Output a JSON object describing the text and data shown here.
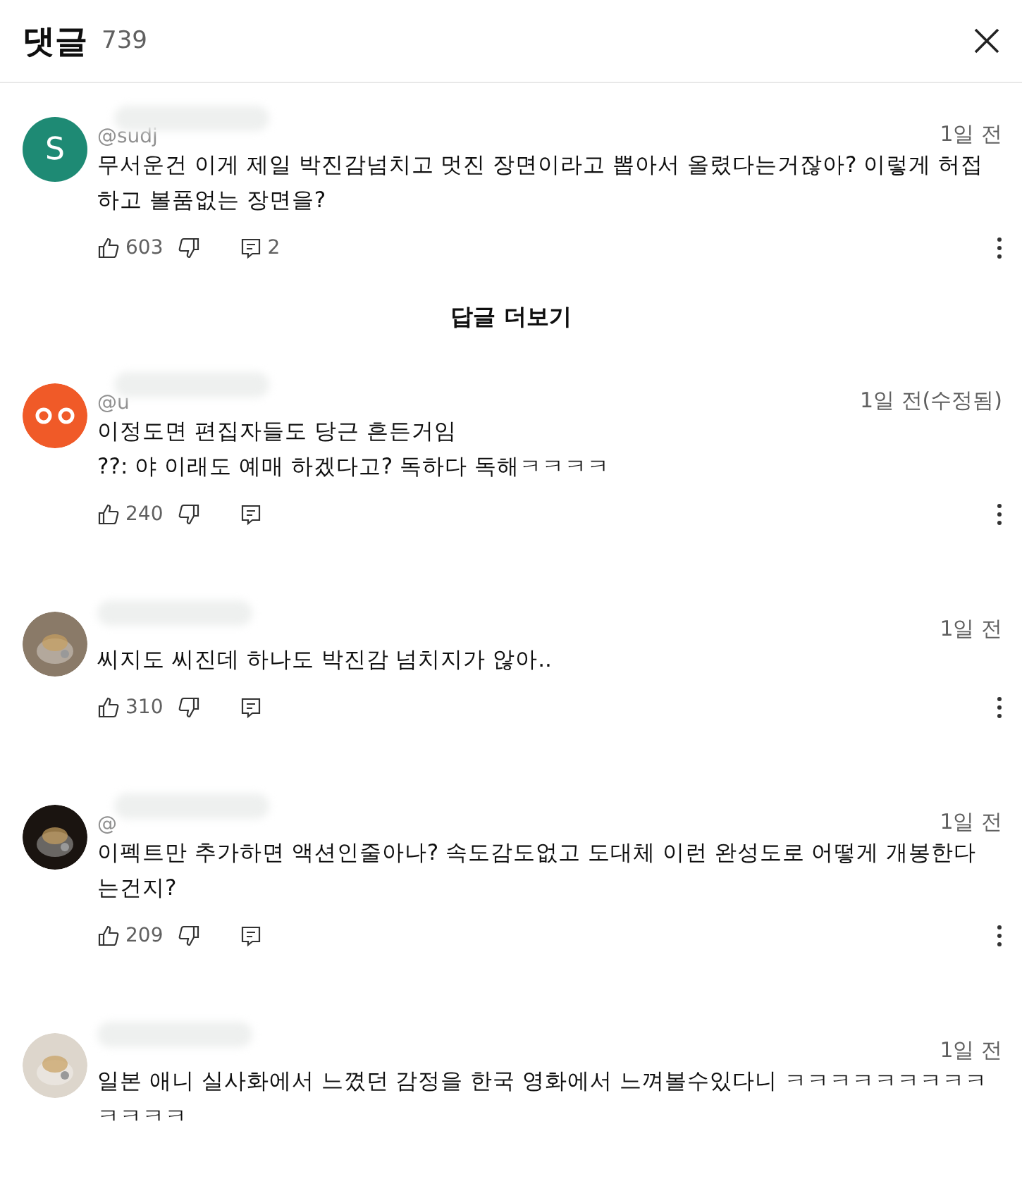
{
  "header": {
    "title": "댓글",
    "count": "739"
  },
  "comments": [
    {
      "avatar": {
        "kind": "letter",
        "letter": "S",
        "color": "#1e8a74"
      },
      "handle": "@sudj",
      "time": "1일 전",
      "text": "무서운건 이게 제일 박진감넘치고 멋진 장면이라고 뽑아서 올렸다는거잖아? 이렇게 허접하고 볼품없는 장면을?",
      "likes": "603",
      "replies": "2",
      "more_replies": "답글 더보기"
    },
    {
      "avatar": {
        "kind": "eyes",
        "color": "#f05a28"
      },
      "handle": "@u",
      "time": "1일 전(수정됨)",
      "text": "이정도면 편집자들도 당근 흔든거임\n??: 야 이래도 예매 하겠다고? 독하다 독해ㅋㅋㅋㅋ",
      "likes": "240"
    },
    {
      "time": "1일 전",
      "text": "씨지도 씨진데 하나도 박진감 넘치지가 않아..",
      "likes": "310"
    },
    {
      "handle": "@",
      "time": "1일 전",
      "text": "이펙트만 추가하면 액션인줄아나? 속도감도없고 도대체 이런 완성도로 어떻게 개봉한다는건지?",
      "likes": "209"
    },
    {
      "time": "1일 전",
      "text": "일본 애니 실사화에서 느꼈던 감정을 한국 영화에서 느껴볼수있다니 ㅋㅋㅋㅋㅋㅋㅋㅋㅋㅋㅋㅋㅋ"
    }
  ]
}
